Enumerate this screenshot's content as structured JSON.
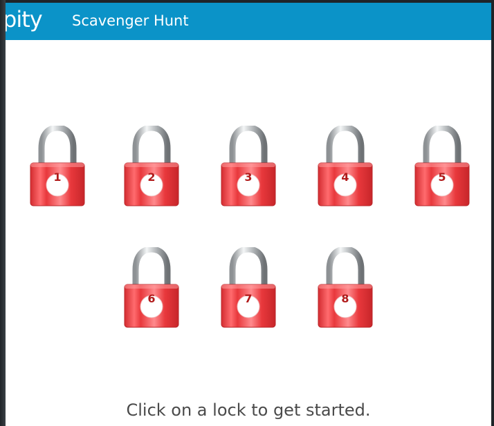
{
  "app": {
    "logo_text": "pity",
    "title": "Scavenger Hunt"
  },
  "locks": [
    {
      "number": "1"
    },
    {
      "number": "2"
    },
    {
      "number": "3"
    },
    {
      "number": "4"
    },
    {
      "number": "5"
    },
    {
      "number": "6"
    },
    {
      "number": "7"
    },
    {
      "number": "8"
    }
  ],
  "instruction": "Click on a lock to get started.",
  "colors": {
    "header": "#0b93c8",
    "lock_body": "#e8383c",
    "lock_number": "#b11a1a"
  }
}
